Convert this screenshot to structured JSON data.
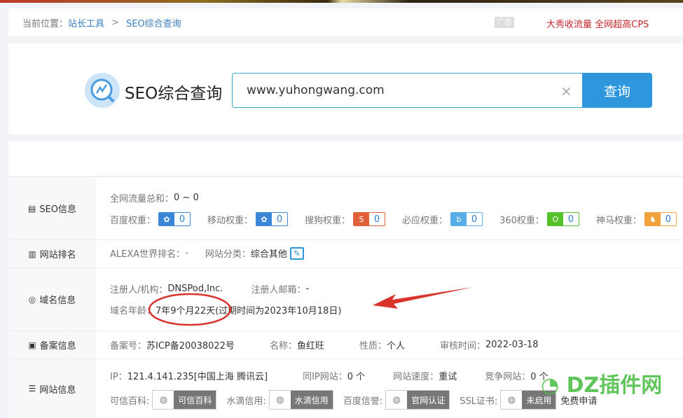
{
  "breadcrumb": {
    "label": "当前位置：",
    "items": [
      "站长工具",
      "SEO综合查询"
    ],
    "sep": ">"
  },
  "ad": {
    "tag": "广告",
    "text": "大秀收流量 全网超高CPS"
  },
  "search": {
    "title": "SEO综合查询",
    "value": "www.yuhongwang.com",
    "clear": "×",
    "button": "查询"
  },
  "seo": {
    "label": "SEO信息",
    "traffic_k": "全网流量总和：",
    "traffic_v": "0 ~ 0",
    "weights": [
      {
        "k": "百度权重：",
        "v": "0",
        "color": "#3b86d8",
        "icon": "paw-icon"
      },
      {
        "k": "移动权重：",
        "v": "0",
        "color": "#3b86d8",
        "icon": "paw-icon"
      },
      {
        "k": "搜狗权重：",
        "v": "0",
        "color": "#e0603a",
        "icon": "sogou-icon"
      },
      {
        "k": "必应权重：",
        "v": "0",
        "color": "#5aaee8",
        "icon": "bing-icon"
      },
      {
        "k": "360权重：",
        "v": "0",
        "color": "#55c12a",
        "icon": "360-icon"
      },
      {
        "k": "神马权重：",
        "v": "0",
        "color": "#f2a23a",
        "icon": "shenma-icon"
      }
    ]
  },
  "rank": {
    "label": "网站排名",
    "alexa_k": "ALEXA世界排名：",
    "alexa_v": "-",
    "cat_k": "网站分类：",
    "cat_v": "综合其他"
  },
  "domain": {
    "label": "域名信息",
    "reg_k": "注册人/机构：",
    "reg_v": "DNSPod,Inc.",
    "mail_k": "注册人邮箱：",
    "mail_v": "-",
    "age_k": "域名年龄：",
    "age_v": "7年9个月22天",
    "expire": "(过期时间为2023年10月18日)"
  },
  "icp": {
    "label": "备案信息",
    "no_k": "备案号：",
    "no_v": "苏ICP备20038022号",
    "name_k": "名称：",
    "name_v": "鱼红旺",
    "type_k": "性质：",
    "type_v": "个人",
    "date_k": "审核时间：",
    "date_v": "2022-03-18"
  },
  "site": {
    "label": "网站信息",
    "ip_k": "IP：",
    "ip_v": "121.4.141.235[中国上海 腾讯云]",
    "same_k": "同IP网站：",
    "same_v": "0 个",
    "speed_k": "网站速度：",
    "speed_v": "重试",
    "comp_k": "竞争网站：",
    "comp_v": "0 个",
    "certs": [
      {
        "k": "可信百科:",
        "t": "可信百科"
      },
      {
        "k": "水滴信用:",
        "t": "水滴信用"
      },
      {
        "k": "百度信誉:",
        "t": "官网认证"
      },
      {
        "k": "SSL证书:",
        "t": "未启用"
      }
    ],
    "ssl_apply": "免费申请"
  },
  "watermark": "DZ插件网",
  "annotation_color": "#d9342b"
}
